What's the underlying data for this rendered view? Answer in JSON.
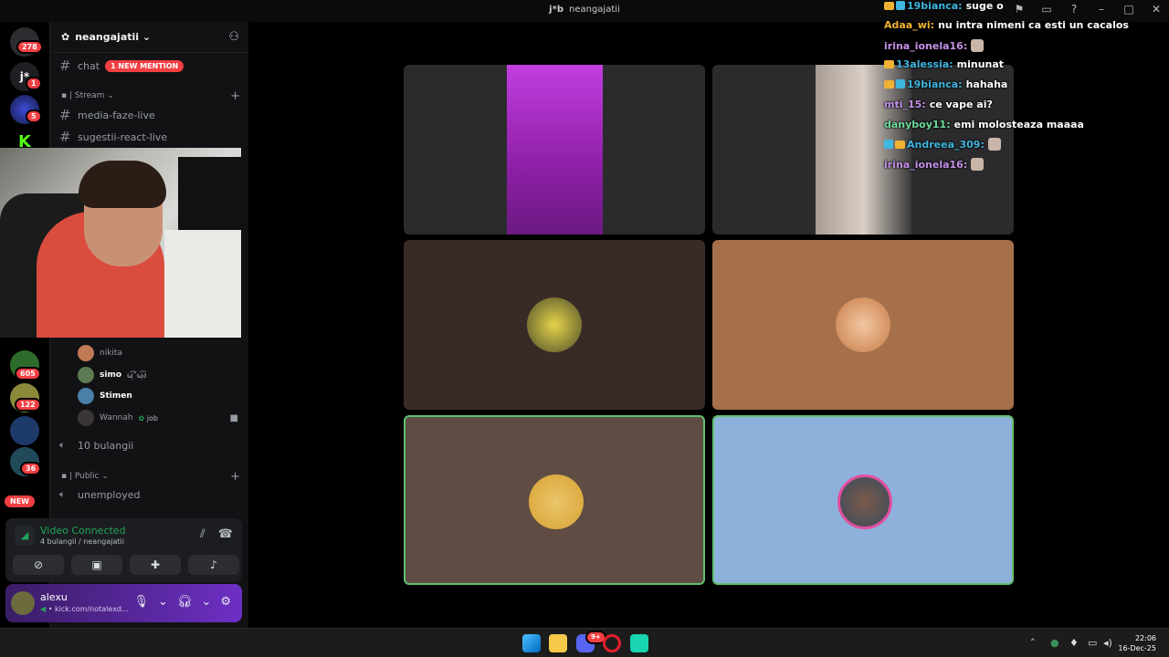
{
  "window": {
    "title": "neangajatii",
    "title_mark": "j*b"
  },
  "titlebar_icons": [
    "inbox-icon",
    "help-icon",
    "minimize-icon",
    "maximize-icon",
    "close-icon"
  ],
  "rail": {
    "badges": [
      "278",
      "1",
      "5",
      "605",
      "122",
      "36"
    ],
    "new_label": "NEW"
  },
  "guild": {
    "name": "neangajatii"
  },
  "channels": {
    "chat": {
      "name": "chat",
      "mention": "1 NEW MENTION"
    },
    "stream_category": "Stream",
    "media": "media-faze-live",
    "sugestii": "sugestii-react-live",
    "voice_bulangii": "10 bulangii",
    "public_category": "Public",
    "unemployed": "unemployed"
  },
  "members": [
    {
      "name": "nikita",
      "tag": ""
    },
    {
      "name": "simo",
      "tag": "ωฺ͡˘ωฺ͡ง"
    },
    {
      "name": "Stimen",
      "tag": ""
    },
    {
      "name": "Wannah",
      "tag": "job"
    }
  ],
  "voice": {
    "status": "Video Connected",
    "location": "4 bulangii / neangajatii"
  },
  "user": {
    "name": "alexu",
    "status": "kick.com/notalexd..."
  },
  "chat_messages": [
    {
      "user": "19bianca:",
      "text": "suge o",
      "color": "#3fb6e0"
    },
    {
      "user": "Adaa_wi:",
      "text": "nu intra nimeni ca esti un cacalos",
      "color": "#f0b232"
    },
    {
      "user": "irina_ionela16:",
      "text": "",
      "color": "#c490e8"
    },
    {
      "user": "13alessia:",
      "text": "minunat",
      "color": "#3fb6e0"
    },
    {
      "user": "19bianca:",
      "text": "hahaha",
      "color": "#3fb6e0"
    },
    {
      "user": "mti_15:",
      "text": "ce vape ai?",
      "color": "#c490e8"
    },
    {
      "user": "danyboy11:",
      "text": "emi molosteaza maaaa",
      "color": "#6fdc9e"
    },
    {
      "user": "Andreea_309:",
      "text": "",
      "color": "#3fb6e0"
    },
    {
      "user": "irina_ionela16:",
      "text": "",
      "color": "#c490e8"
    }
  ],
  "taskbar": {
    "time": "22:06",
    "date": "16-Dec-25",
    "discord_badge": "9+"
  },
  "colors": {
    "tile_dark": "#3a2a26",
    "tile_orange": "#a5704a",
    "tile_taupe": "#5f4d44",
    "tile_blue": "#8eb1dc",
    "speaking": "#5fbf6e"
  }
}
